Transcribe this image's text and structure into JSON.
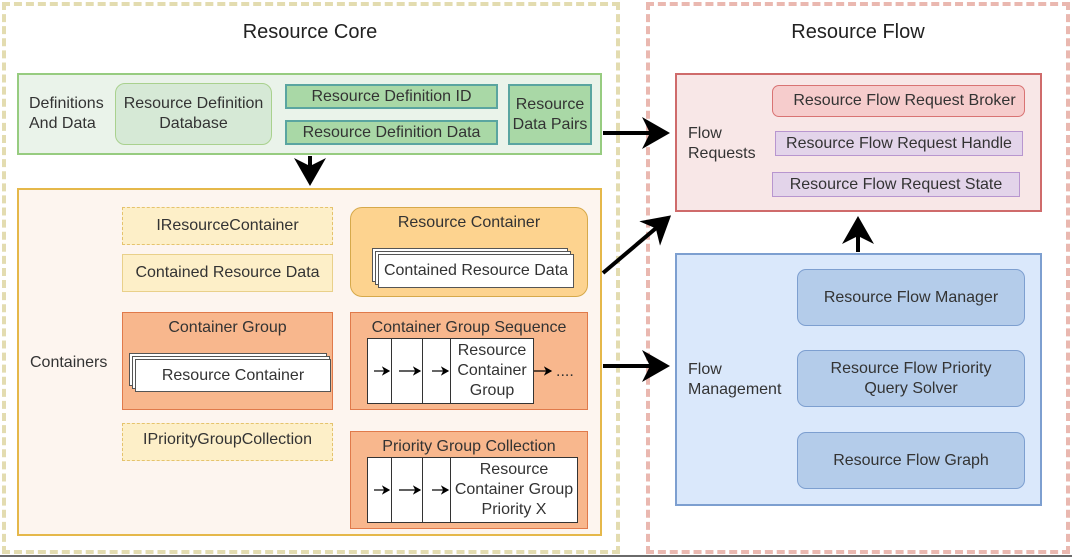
{
  "sections": {
    "core_title": "Resource Core",
    "flow_title": "Resource Flow"
  },
  "definitions": {
    "label_line1": "Definitions",
    "label_line2": "And Data",
    "database_line1": "Resource Definition",
    "database_line2": "Database",
    "definition_id": "Resource Definition ID",
    "definition_data": "Resource Definition Data",
    "data_pairs_line1": "Resource",
    "data_pairs_line2": "Data Pairs"
  },
  "containers": {
    "label": "Containers",
    "iresource_container": "IResourceContainer",
    "contained_resource_data": "Contained Resource Data",
    "resource_container": {
      "title": "Resource Container",
      "inner": "Contained Resource Data"
    },
    "container_group": {
      "title": "Container Group",
      "inner": "Resource Container"
    },
    "container_group_sequence": {
      "title": "Container Group Sequence",
      "cell_line1": "Resource",
      "cell_line2": "Container",
      "cell_line3": "Group",
      "ellipsis": "...."
    },
    "ipriority_group_collection": "IPriorityGroupCollection",
    "priority_group_collection": {
      "title": "Priority Group Collection",
      "cell_line1": "Resource",
      "cell_line2": "Container Group",
      "cell_line3": "Priority X"
    }
  },
  "flow_requests": {
    "label_line1": "Flow",
    "label_line2": "Requests",
    "items": [
      "Resource Flow Request Broker",
      "Resource Flow Request Handle",
      "Resource Flow Request State"
    ]
  },
  "flow_management": {
    "label_line1": "Flow",
    "label_line2": "Management",
    "manager": "Resource Flow Manager",
    "solver_line1": "Resource Flow Priority",
    "solver_line2": "Query Solver",
    "graph": "Resource Flow Graph"
  },
  "colors": {
    "core_border": "#e3dcb0",
    "flow_border": "#eab8b0",
    "definitions_fill": "#eaf3ea",
    "containers_fill": "#fdf5ef",
    "requests_fill": "#f8e7e7",
    "management_fill": "#dae8fb"
  }
}
